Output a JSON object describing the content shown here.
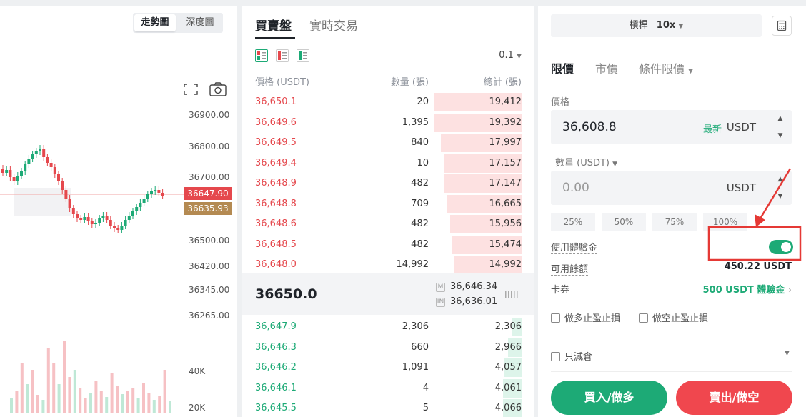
{
  "chart": {
    "tabs": [
      "走勢圖",
      "深度圖"
    ],
    "price_ticks": [
      "36900.00",
      "36800.00",
      "36700.00",
      "36500.00",
      "36420.00",
      "36345.00",
      "36265.00"
    ],
    "last_price_tag": "36647.90",
    "mark_price_tag": "36635.93",
    "volume_ticks": [
      "40K",
      "20K"
    ],
    "colors": {
      "up": "#1daa76",
      "down": "#e5484d",
      "mark_tag": "#b48a52"
    },
    "icons": [
      "fullscreen-icon",
      "camera-icon"
    ]
  },
  "order_book": {
    "tabs": [
      "買賣盤",
      "實時交易"
    ],
    "precision": "0.1",
    "columns": [
      "價格 (USDT)",
      "數量 (張)",
      "總計 (張)"
    ],
    "asks": [
      {
        "price": "36,650.1",
        "qty": "20",
        "total": "19,412"
      },
      {
        "price": "36,649.6",
        "qty": "1,395",
        "total": "19,392"
      },
      {
        "price": "36,649.5",
        "qty": "840",
        "total": "17,997"
      },
      {
        "price": "36,649.4",
        "qty": "10",
        "total": "17,157"
      },
      {
        "price": "36,648.9",
        "qty": "482",
        "total": "17,147"
      },
      {
        "price": "36,648.8",
        "qty": "709",
        "total": "16,665"
      },
      {
        "price": "36,648.6",
        "qty": "482",
        "total": "15,956"
      },
      {
        "price": "36,648.5",
        "qty": "482",
        "total": "15,474"
      },
      {
        "price": "36,648.0",
        "qty": "14,992",
        "total": "14,992"
      }
    ],
    "last_price": "36650.0",
    "mark_label": "M",
    "mark_price": "36,646.34",
    "index_label": "IN",
    "index_price": "36,636.01",
    "bids": [
      {
        "price": "36,647.9",
        "qty": "2,306",
        "total": "2,306"
      },
      {
        "price": "36,646.3",
        "qty": "660",
        "total": "2,966"
      },
      {
        "price": "36,646.2",
        "qty": "1,091",
        "total": "4,057"
      },
      {
        "price": "36,646.1",
        "qty": "4",
        "total": "4,061"
      },
      {
        "price": "36,645.5",
        "qty": "5",
        "total": "4,066"
      }
    ]
  },
  "trade": {
    "leverage_label": "槓桿",
    "leverage_value": "10x",
    "order_tabs": [
      "限價",
      "市價",
      "條件限價"
    ],
    "price_label": "價格",
    "price_value": "36,608.8",
    "latest_label": "最新",
    "unit": "USDT",
    "qty_label": "數量 (USDT)",
    "qty_placeholder": "0.00",
    "percent_options": [
      "25%",
      "50%",
      "75%",
      "100%"
    ],
    "bonus_label": "使用體驗金",
    "bonus_enabled": true,
    "available_label": "可用餘額",
    "available_value": "450.22 USDT",
    "coupon_label": "卡券",
    "coupon_value": "500 USDT 體驗金",
    "long_tpsl_label": "做多止盈止損",
    "short_tpsl_label": "做空止盈止損",
    "reduce_only_label": "只減倉",
    "buy_label": "買入/做多",
    "sell_label": "賣出/做空",
    "colors": {
      "buy": "#1daa76",
      "sell": "#f0474e",
      "annotation": "#e53935"
    }
  }
}
